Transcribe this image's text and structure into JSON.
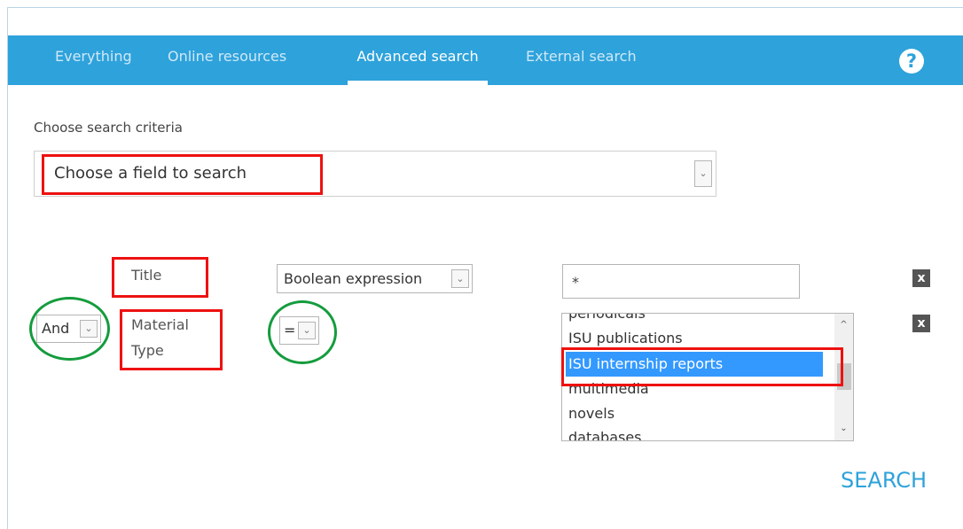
{
  "nav": {
    "tabs": [
      {
        "label": "Everything"
      },
      {
        "label": "Online resources"
      },
      {
        "label": "Advanced search"
      },
      {
        "label": "External search"
      }
    ],
    "help_glyph": "?",
    "help_icon": "question-circle-icon"
  },
  "form": {
    "criteria_label": "Choose search criteria",
    "field_select": {
      "value": "Choose a field to search"
    },
    "rows": [
      {
        "field_label": "Title",
        "operator": "Boolean expression",
        "value": "*",
        "remove_label": "x"
      },
      {
        "connector": "And",
        "field_label_line1": "Material",
        "field_label_line2": "Type",
        "operator": "=",
        "remove_label": "x"
      }
    ],
    "material_type_options": [
      "periodicals",
      "ISU publications",
      "ISU internship reports",
      "multimedia",
      "novels",
      "databases"
    ],
    "selected_option": "ISU internship reports",
    "search_label": "SEARCH"
  },
  "colors": {
    "nav_bg": "#2ea2db",
    "highlight_red": "#ee1111",
    "highlight_green": "#149c3d",
    "selection_blue": "#3399ff"
  }
}
